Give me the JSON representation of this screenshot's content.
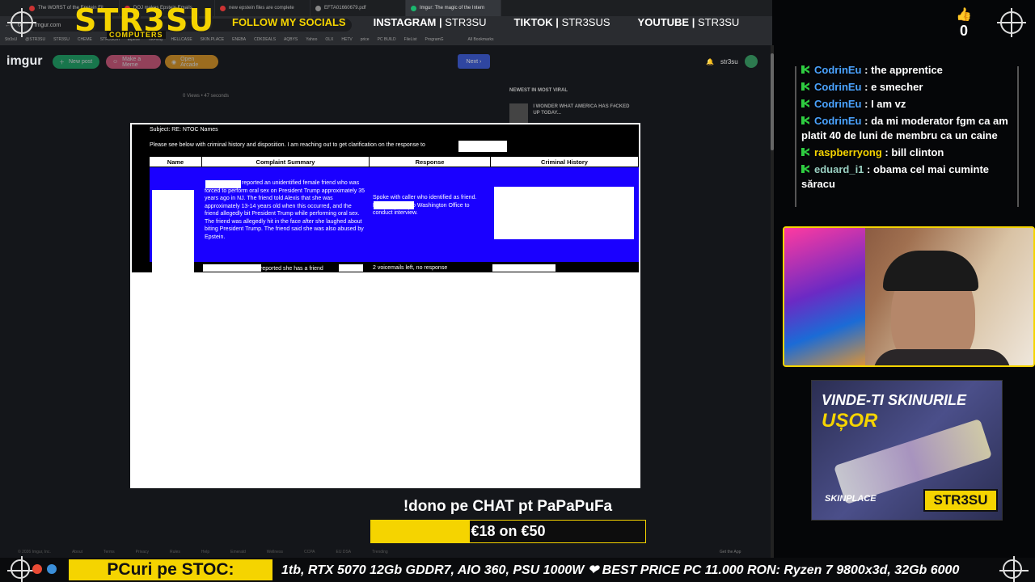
{
  "browser": {
    "tabs": [
      {
        "label": "The WORST of the Epstein Fil"
      },
      {
        "label": "DOJ makes Epstein Emails"
      },
      {
        "label": "new epstein files are complete"
      },
      {
        "label": "EFTA01660679.pdf"
      },
      {
        "label": "Imgur: The magic of the Intern"
      }
    ],
    "url": "imgur.com",
    "bookmarks": [
      "Str3sU",
      "@STR3SU",
      "STR3SU",
      "CHEME",
      "STR3SUm",
      "Elpexe",
      "TikFinity",
      "HELLCASE",
      "SKIN.PLACE",
      "ENEBA",
      "CDKDEALS",
      "AQBYS",
      "Yahoo",
      "OLX",
      "HETV",
      "price",
      "PC BUILD",
      "FileList",
      "ProgramG",
      "All Bookmarks"
    ]
  },
  "overlay": {
    "brand": "STR3SU",
    "brand_sub": "COMPUTERS",
    "follow": "FOLLOW MY SOCIALS",
    "socials": [
      {
        "platform": "INSTAGRAM",
        "handle": "STR3SU"
      },
      {
        "platform": "TIKTOK",
        "handle": "STR3SUS"
      },
      {
        "platform": "YOUTUBE",
        "handle": "STR3SU"
      }
    ],
    "likes": "0"
  },
  "imgur": {
    "logo": "imgur",
    "new_post": "New post",
    "make_meme": "Make a Meme",
    "open_arcade": "Open Arcade",
    "next": "Next",
    "username": "str3su",
    "meta": "0 Views • 47 seconds",
    "newest_label": "NEWEST IN MOST VIRAL",
    "viral_title": "I WONDER WHAT AMERICA HAS F#CKED UP TODAY...",
    "footer": [
      "© 2026 Imgur, Inc.",
      "About",
      "Terms",
      "Privacy",
      "Rules",
      "Help",
      "Emerald",
      "Wellness",
      "CCPA",
      "EU DSA",
      "Trending"
    ],
    "get_app": "Get the App"
  },
  "document": {
    "subject": "Subject:  RE: NTOC Names",
    "intro": "Please see below with criminal history and disposition.  I am reaching out to get clarification on the response to",
    "headers": [
      "Name",
      "Complaint Summary",
      "Response",
      "Criminal History"
    ],
    "complaint": "reported an unidentified female friend who was forced to perform oral sex on President Trump approximately 35 years ago in NJ. The friend told Alexis that she was approximately 13-14 years old when this occurred, and the friend allegedly bit President Trump while performing oral sex. The friend was allegedly hit in the face after she laughed about biting President Trump. The friend said she was also abused by Epstein.",
    "response": "Spoke with caller who identified  as friend. Lead was sent to Washington Office to conduct interview.",
    "row2_complaint": "reported she has a friend",
    "row2_response": "2 voicemails left, no response"
  },
  "donation": {
    "title": "!dono pe CHAT pt PaPaPuFa",
    "progress_text": "€18 on €50",
    "progress": 0.36
  },
  "chat": [
    {
      "user": "CodrinEu",
      "text": "the apprentice",
      "color": "#4aa3ff"
    },
    {
      "user": "CodrinEu",
      "text": "e smecher",
      "color": "#4aa3ff"
    },
    {
      "user": "CodrinEu",
      "text": "I am vz",
      "color": "#4aa3ff"
    },
    {
      "user": "CodrinEu",
      "text": "da mi moderator fgm ca am platit 40 de luni de membru ca un caine",
      "color": "#4aa3ff"
    },
    {
      "user": "raspberryong",
      "text": "bill clinton",
      "color": "#f5d400"
    },
    {
      "user": "eduard_i1",
      "text": "obama cel mai cuminte săracu",
      "color": "#9ad0c2"
    }
  ],
  "ad": {
    "line1": "VINDE-TI SKINURILE",
    "line2": "UȘOR",
    "brand": "SKINPLACE",
    "tag": "STR3SU"
  },
  "ticker": {
    "label": "PCuri pe STOC:",
    "text": "1tb, RTX 5070 12Gb GDDR7, AIO 360, PSU 1000W ❤ BEST PRICE PC 11.000 RON: Ryzen 7 9800x3d, 32Gb 6000"
  }
}
